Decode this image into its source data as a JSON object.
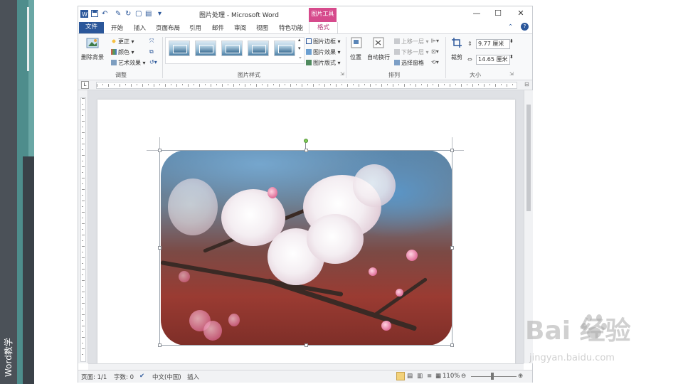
{
  "window": {
    "title": "图片处理 - Microsoft Word",
    "context_tab_group": "图片工具",
    "controls": {
      "help": "?"
    }
  },
  "side_label": "Word教学",
  "tabs": [
    "文件",
    "开始",
    "插入",
    "页面布局",
    "引用",
    "邮件",
    "审阅",
    "视图",
    "特色功能",
    "格式"
  ],
  "ribbon": {
    "adjust": {
      "remove_bg": "删除背景",
      "correct": "更正",
      "color": "颜色",
      "artistic": "艺术效果",
      "label": "调整"
    },
    "styles": {
      "border": "图片边框",
      "effects": "图片效果",
      "layout": "图片版式",
      "label": "图片样式"
    },
    "arrange": {
      "position": "位置",
      "wrap": "自动换行",
      "bring_forward": "上移一层",
      "send_backward": "下移一层",
      "selection_pane": "选择窗格",
      "label": "排列"
    },
    "size": {
      "crop": "裁剪",
      "height": "9.77 厘米",
      "width": "14.65 厘米",
      "label": "大小"
    }
  },
  "status": {
    "page": "页面: 1/1",
    "words": "字数: 0",
    "language": "中文(中国)",
    "mode": "插入",
    "zoom": "110%"
  },
  "watermark": {
    "logo": "Bai  经验",
    "site": "jingyan.baidu.com"
  },
  "colors": {
    "word_blue": "#2b579a",
    "picture_tools": "#d64a8c"
  }
}
